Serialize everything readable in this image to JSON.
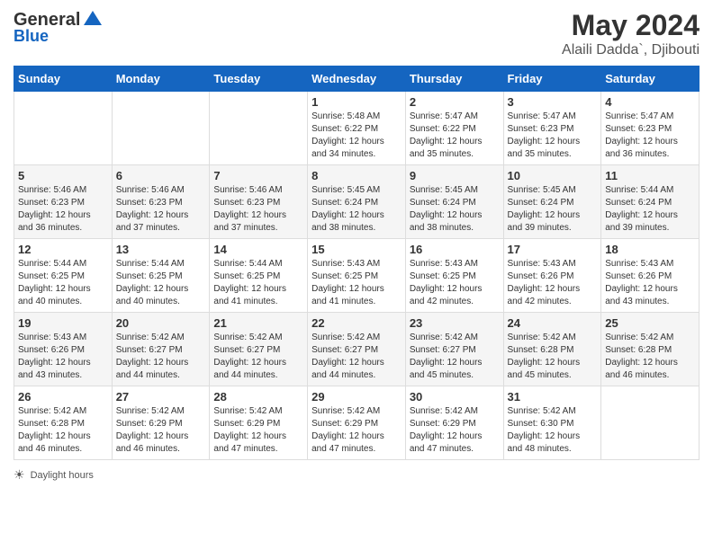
{
  "header": {
    "logo_general": "General",
    "logo_blue": "Blue",
    "main_title": "May 2024",
    "subtitle": "Alaili Dadda`, Djibouti"
  },
  "days_of_week": [
    "Sunday",
    "Monday",
    "Tuesday",
    "Wednesday",
    "Thursday",
    "Friday",
    "Saturday"
  ],
  "weeks": [
    [
      {
        "day": "",
        "info": ""
      },
      {
        "day": "",
        "info": ""
      },
      {
        "day": "",
        "info": ""
      },
      {
        "day": "1",
        "info": "Sunrise: 5:48 AM\nSunset: 6:22 PM\nDaylight: 12 hours and 34 minutes."
      },
      {
        "day": "2",
        "info": "Sunrise: 5:47 AM\nSunset: 6:22 PM\nDaylight: 12 hours and 35 minutes."
      },
      {
        "day": "3",
        "info": "Sunrise: 5:47 AM\nSunset: 6:23 PM\nDaylight: 12 hours and 35 minutes."
      },
      {
        "day": "4",
        "info": "Sunrise: 5:47 AM\nSunset: 6:23 PM\nDaylight: 12 hours and 36 minutes."
      }
    ],
    [
      {
        "day": "5",
        "info": "Sunrise: 5:46 AM\nSunset: 6:23 PM\nDaylight: 12 hours and 36 minutes."
      },
      {
        "day": "6",
        "info": "Sunrise: 5:46 AM\nSunset: 6:23 PM\nDaylight: 12 hours and 37 minutes."
      },
      {
        "day": "7",
        "info": "Sunrise: 5:46 AM\nSunset: 6:23 PM\nDaylight: 12 hours and 37 minutes."
      },
      {
        "day": "8",
        "info": "Sunrise: 5:45 AM\nSunset: 6:24 PM\nDaylight: 12 hours and 38 minutes."
      },
      {
        "day": "9",
        "info": "Sunrise: 5:45 AM\nSunset: 6:24 PM\nDaylight: 12 hours and 38 minutes."
      },
      {
        "day": "10",
        "info": "Sunrise: 5:45 AM\nSunset: 6:24 PM\nDaylight: 12 hours and 39 minutes."
      },
      {
        "day": "11",
        "info": "Sunrise: 5:44 AM\nSunset: 6:24 PM\nDaylight: 12 hours and 39 minutes."
      }
    ],
    [
      {
        "day": "12",
        "info": "Sunrise: 5:44 AM\nSunset: 6:25 PM\nDaylight: 12 hours and 40 minutes."
      },
      {
        "day": "13",
        "info": "Sunrise: 5:44 AM\nSunset: 6:25 PM\nDaylight: 12 hours and 40 minutes."
      },
      {
        "day": "14",
        "info": "Sunrise: 5:44 AM\nSunset: 6:25 PM\nDaylight: 12 hours and 41 minutes."
      },
      {
        "day": "15",
        "info": "Sunrise: 5:43 AM\nSunset: 6:25 PM\nDaylight: 12 hours and 41 minutes."
      },
      {
        "day": "16",
        "info": "Sunrise: 5:43 AM\nSunset: 6:25 PM\nDaylight: 12 hours and 42 minutes."
      },
      {
        "day": "17",
        "info": "Sunrise: 5:43 AM\nSunset: 6:26 PM\nDaylight: 12 hours and 42 minutes."
      },
      {
        "day": "18",
        "info": "Sunrise: 5:43 AM\nSunset: 6:26 PM\nDaylight: 12 hours and 43 minutes."
      }
    ],
    [
      {
        "day": "19",
        "info": "Sunrise: 5:43 AM\nSunset: 6:26 PM\nDaylight: 12 hours and 43 minutes."
      },
      {
        "day": "20",
        "info": "Sunrise: 5:42 AM\nSunset: 6:27 PM\nDaylight: 12 hours and 44 minutes."
      },
      {
        "day": "21",
        "info": "Sunrise: 5:42 AM\nSunset: 6:27 PM\nDaylight: 12 hours and 44 minutes."
      },
      {
        "day": "22",
        "info": "Sunrise: 5:42 AM\nSunset: 6:27 PM\nDaylight: 12 hours and 44 minutes."
      },
      {
        "day": "23",
        "info": "Sunrise: 5:42 AM\nSunset: 6:27 PM\nDaylight: 12 hours and 45 minutes."
      },
      {
        "day": "24",
        "info": "Sunrise: 5:42 AM\nSunset: 6:28 PM\nDaylight: 12 hours and 45 minutes."
      },
      {
        "day": "25",
        "info": "Sunrise: 5:42 AM\nSunset: 6:28 PM\nDaylight: 12 hours and 46 minutes."
      }
    ],
    [
      {
        "day": "26",
        "info": "Sunrise: 5:42 AM\nSunset: 6:28 PM\nDaylight: 12 hours and 46 minutes."
      },
      {
        "day": "27",
        "info": "Sunrise: 5:42 AM\nSunset: 6:29 PM\nDaylight: 12 hours and 46 minutes."
      },
      {
        "day": "28",
        "info": "Sunrise: 5:42 AM\nSunset: 6:29 PM\nDaylight: 12 hours and 47 minutes."
      },
      {
        "day": "29",
        "info": "Sunrise: 5:42 AM\nSunset: 6:29 PM\nDaylight: 12 hours and 47 minutes."
      },
      {
        "day": "30",
        "info": "Sunrise: 5:42 AM\nSunset: 6:29 PM\nDaylight: 12 hours and 47 minutes."
      },
      {
        "day": "31",
        "info": "Sunrise: 5:42 AM\nSunset: 6:30 PM\nDaylight: 12 hours and 48 minutes."
      },
      {
        "day": "",
        "info": ""
      }
    ]
  ],
  "footer": {
    "label": "Daylight hours"
  }
}
